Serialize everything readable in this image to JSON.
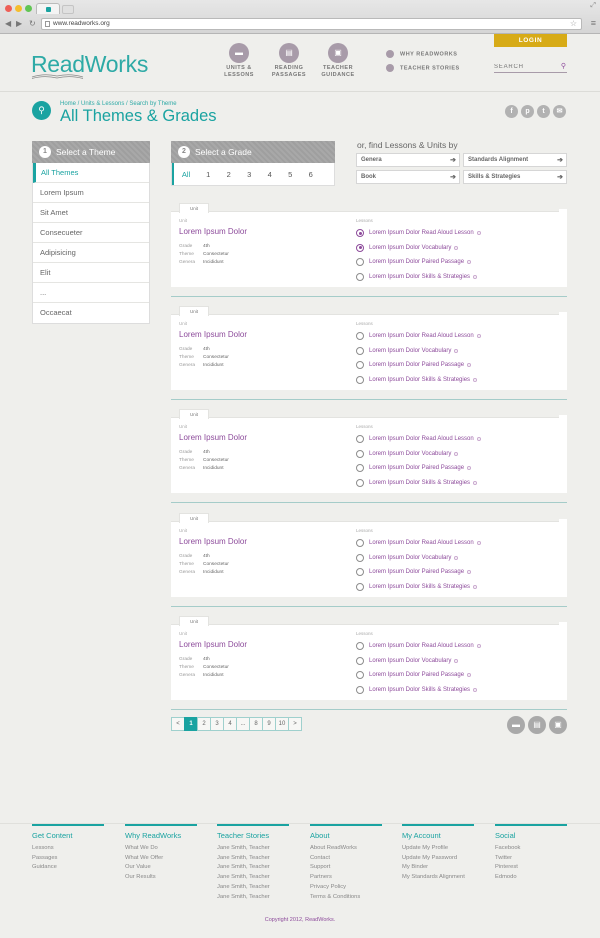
{
  "browser": {
    "url": "www.readworks.org"
  },
  "header": {
    "logo": "ReadWorks",
    "login_label": "LOGIN",
    "nav": [
      {
        "line1": "UNITS &",
        "line2": "LESSONS",
        "icon": "folder-icon"
      },
      {
        "line1": "READING",
        "line2": "PASSAGES",
        "icon": "document-icon"
      },
      {
        "line1": "TEACHER",
        "line2": "GUIDANCE",
        "icon": "briefcase-icon"
      }
    ],
    "side_links": [
      "WHY READWORKS",
      "TEACHER STORIES"
    ],
    "search_placeholder": "SEARCH"
  },
  "page": {
    "breadcrumb": "Home / Units & Lessons / Search by Theme",
    "title": "All Themes & Grades"
  },
  "theme_panel": {
    "step": "1",
    "heading": "Select a Theme",
    "items": [
      "All Themes",
      "Lorem Ipsum",
      "Sit Amet",
      "Consecueter",
      "Adipisicing",
      "Elit",
      "...",
      "Occaecat"
    ]
  },
  "grade_panel": {
    "step": "2",
    "heading": "Select a Grade",
    "grades": [
      "All",
      "1",
      "2",
      "3",
      "4",
      "5",
      "6"
    ]
  },
  "find": {
    "label": "or, find Lessons & Units by",
    "buttons": [
      "Genera",
      "Standards Alignment",
      "Book",
      "Skills & Strategies"
    ]
  },
  "card_labels": {
    "tab": "Unit",
    "unit": "Unit",
    "lessons": "Lessons",
    "grade_key": "Grade",
    "theme_key": "Theme",
    "genera_key": "Genera"
  },
  "units": [
    {
      "name": "Lorem Ipsum Dolor",
      "grade": "4th",
      "theme": "Consectetur",
      "genera": "Incididunt",
      "lessons": [
        "Lorem Ipsum Dolor Read Aloud Lesson",
        "Lorem Ipsum Dolor Vocabulary",
        "Lorem Ipsum Dolor Paired Passage",
        "Lorem Ipsum Dolor Skills & Strategies"
      ],
      "checked": [
        true,
        true,
        false,
        false
      ]
    },
    {
      "name": "Lorem Ipsum Dolor",
      "grade": "4th",
      "theme": "Consectetur",
      "genera": "Incididunt",
      "lessons": [
        "Lorem Ipsum Dolor Read Aloud Lesson",
        "Lorem Ipsum Dolor Vocabulary",
        "Lorem Ipsum Dolor Paired Passage",
        "Lorem Ipsum Dolor Skills & Strategies"
      ],
      "checked": [
        false,
        false,
        false,
        false
      ]
    },
    {
      "name": "Lorem Ipsum Dolor",
      "grade": "4th",
      "theme": "Consectetur",
      "genera": "Incididunt",
      "lessons": [
        "Lorem Ipsum Dolor Read Aloud Lesson",
        "Lorem Ipsum Dolor Vocabulary",
        "Lorem Ipsum Dolor Paired Passage",
        "Lorem Ipsum Dolor Skills & Strategies"
      ],
      "checked": [
        false,
        false,
        false,
        false
      ]
    },
    {
      "name": "Lorem Ipsum Dolor",
      "grade": "4th",
      "theme": "Consectetur",
      "genera": "Incididunt",
      "lessons": [
        "Lorem Ipsum Dolor Read Aloud Lesson",
        "Lorem Ipsum Dolor Vocabulary",
        "Lorem Ipsum Dolor Paired Passage",
        "Lorem Ipsum Dolor Skills & Strategies"
      ],
      "checked": [
        false,
        false,
        false,
        false
      ]
    },
    {
      "name": "Lorem Ipsum Dolor",
      "grade": "4th",
      "theme": "Consectetur",
      "genera": "Incididunt",
      "lessons": [
        "Lorem Ipsum Dolor Read Aloud Lesson",
        "Lorem Ipsum Dolor Vocabulary",
        "Lorem Ipsum Dolor Paired Passage",
        "Lorem Ipsum Dolor Skills & Strategies"
      ],
      "checked": [
        false,
        false,
        false,
        false
      ]
    }
  ],
  "pagination": {
    "prev": "<",
    "pages": [
      "1",
      "2",
      "3",
      "4",
      "...",
      "8",
      "9",
      "10"
    ],
    "next": ">",
    "current": "1"
  },
  "footer": {
    "columns": [
      {
        "title": "Get Content",
        "links": [
          "Lessons",
          "Passages",
          "Guidance"
        ]
      },
      {
        "title": "Why ReadWorks",
        "links": [
          "What We Do",
          "What We Offer",
          "Our Value",
          "Our Results"
        ]
      },
      {
        "title": "Teacher Stories",
        "links": [
          "Jane Smith, Teacher",
          "Jane Smith, Teacher",
          "Jane Smith, Teacher",
          "Jane Smith, Teacher",
          "Jane Smith, Teacher",
          "Jane Smith, Teacher"
        ]
      },
      {
        "title": "About",
        "links": [
          "About ReadWorks",
          "Contact",
          "Support",
          "Partners",
          "Privacy Policy",
          "Terms & Conditions"
        ]
      },
      {
        "title": "My Account",
        "links": [
          "Update My Profile",
          "Update My Password",
          "My Binder",
          "My Standards Alignment"
        ]
      },
      {
        "title": "Social",
        "links": [
          "Facebook",
          "Twitter",
          "Pinterest",
          "Edmodo"
        ]
      }
    ],
    "copyright": "Copyright 2012, ReadWorks."
  },
  "colors": {
    "teal": "#1aa3a1",
    "purple": "#8d4b9b",
    "gold": "#d7ab17",
    "mauve": "#a89ba9"
  }
}
